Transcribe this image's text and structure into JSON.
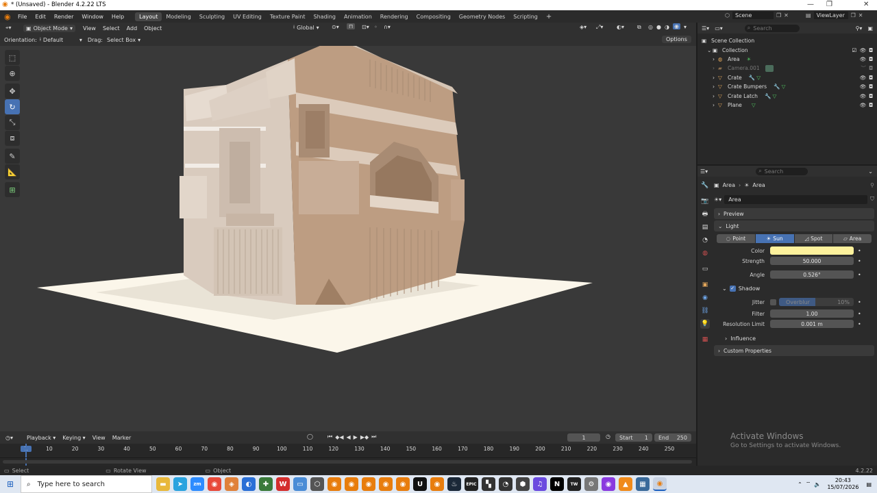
{
  "window": {
    "title": "* (Unsaved) - Blender 4.2.22 LTS",
    "min": "—",
    "max": "❐",
    "close": "✕"
  },
  "menu": {
    "items": [
      "File",
      "Edit",
      "Render",
      "Window",
      "Help"
    ]
  },
  "workspaces": [
    "Layout",
    "Modeling",
    "Sculpting",
    "UV Editing",
    "Texture Paint",
    "Shading",
    "Animation",
    "Rendering",
    "Compositing",
    "Geometry Nodes",
    "Scripting"
  ],
  "workspace_add": "+",
  "topright": {
    "scene": "Scene",
    "view_layer": "ViewLayer"
  },
  "viewport_header": {
    "mode": "Object Mode",
    "menus": [
      "View",
      "Select",
      "Add",
      "Object"
    ],
    "transform": "Global"
  },
  "viewport_sub": {
    "orientation_label": "Orientation:",
    "orientation_value": "Default",
    "drag_label": "Drag:",
    "drag_value": "Select Box",
    "options": "Options"
  },
  "outliner": {
    "search_placeholder": "Search",
    "scene_collection": "Scene Collection",
    "collection": "Collection",
    "items": [
      "Area",
      "Camera.001",
      "Crate",
      "Crate Bumpers",
      "Crate Latch",
      "Plane"
    ]
  },
  "properties": {
    "search_placeholder": "Search",
    "breadcrumb": [
      "Area",
      "Area"
    ],
    "data_name": "Area",
    "preview": "Preview",
    "light": "Light",
    "types": [
      "Point",
      "Sun",
      "Spot",
      "Area"
    ],
    "active_type": "Sun",
    "color_label": "Color",
    "color_value": "#fdf19c",
    "strength_label": "Strength",
    "strength_value": "50.000",
    "angle_label": "Angle",
    "angle_value": "0.526°",
    "shadow": "Shadow",
    "jitter_label": "Jitter",
    "overblur_label": "Overblur",
    "overblur_value": "10%",
    "filter_label": "Filter",
    "filter_value": "1.00",
    "resolution_label": "Resolution Limit",
    "resolution_value": "0.001 m",
    "influence": "Influence",
    "custom": "Custom Properties"
  },
  "timeline": {
    "menus": [
      "Playback",
      "Keying",
      "View",
      "Marker"
    ],
    "current_frame": "1",
    "start_label": "Start",
    "start_value": "1",
    "end_label": "End",
    "end_value": "250",
    "ticks": [
      "1",
      "10",
      "20",
      "30",
      "40",
      "50",
      "60",
      "70",
      "80",
      "90",
      "100",
      "110",
      "120",
      "130",
      "140",
      "150",
      "160",
      "170",
      "180",
      "190",
      "200",
      "210",
      "220",
      "230",
      "240",
      "250"
    ]
  },
  "status": {
    "select": "Select",
    "rotate": "Rotate View",
    "object": "Object",
    "version": "4.2.22"
  },
  "watermark": {
    "title": "Activate Windows",
    "subtitle": "Go to Settings to activate Windows."
  },
  "taskbar": {
    "search_placeholder": "Type here to search",
    "time": "20:43",
    "date": "15/07/2026"
  },
  "colors": {
    "accent": "#4772b3",
    "sun_color": "#fdf19c",
    "crate": "#c9b9a7",
    "plane": "#fbf6ea"
  }
}
